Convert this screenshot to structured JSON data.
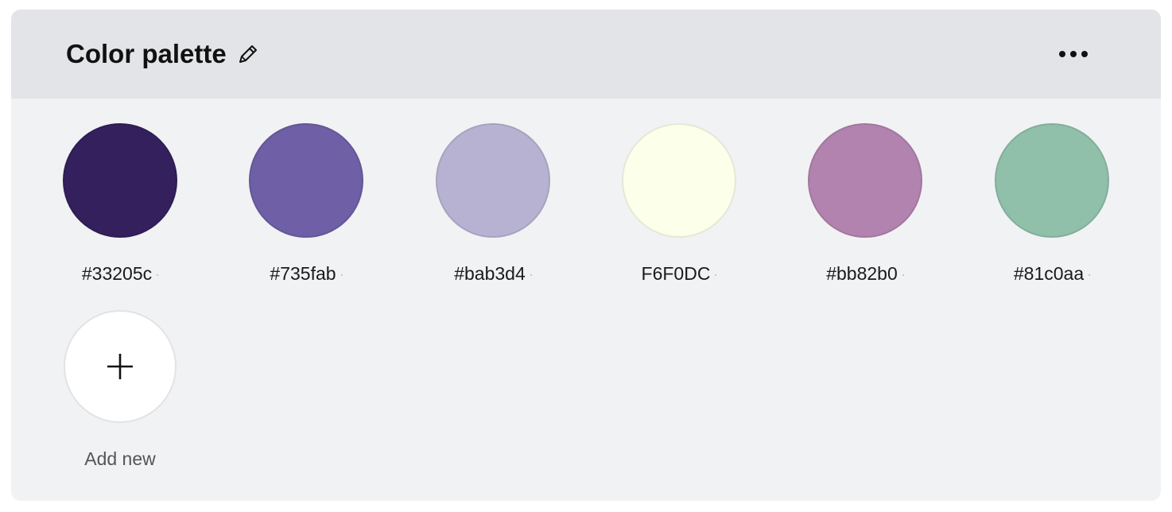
{
  "palette": {
    "title": "Color palette",
    "edit_icon": "pencil-icon",
    "more_icon": "more-horizontal-icon",
    "swatches": [
      {
        "label": "#33205c",
        "color": "#33205c"
      },
      {
        "label": "#735fab",
        "color": "#6f5fa6"
      },
      {
        "label": "#bab3d4",
        "color": "#b8b2d2"
      },
      {
        "label": "F6F0DC",
        "color": "#fcffea"
      },
      {
        "label": "#bb82b0",
        "color": "#b283ae"
      },
      {
        "label": "#81c0aa",
        "color": "#90bfaa"
      }
    ],
    "add_new_label": "Add new",
    "add_icon": "plus-icon"
  }
}
